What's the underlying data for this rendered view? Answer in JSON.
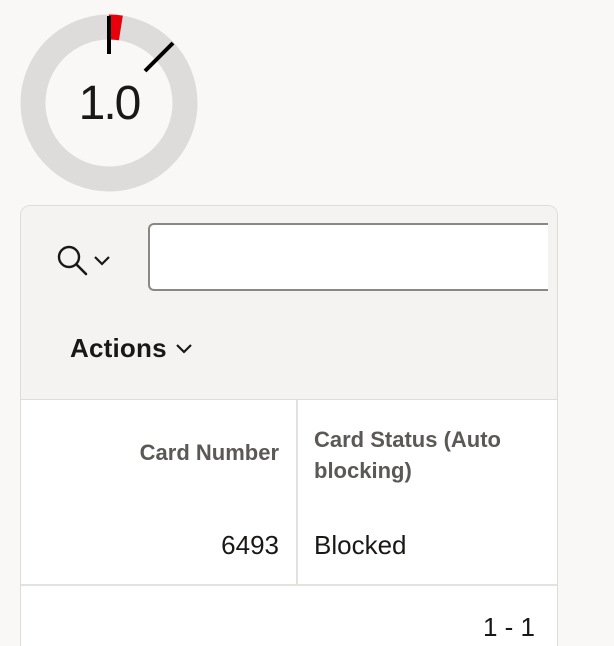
{
  "gauge": {
    "value_label": "1.0",
    "fraction": 0.025,
    "colors": {
      "track": "#dddcda",
      "fill": "#e8000b",
      "marker": "#000000"
    },
    "icon": "gauge-ring"
  },
  "report": {
    "search": {
      "icon": "search-icon",
      "dropdown_icon": "chevron-down-icon",
      "value": "",
      "placeholder": ""
    },
    "actions_label": "Actions",
    "columns": [
      "Card Number",
      "Card Status (Auto blocking)"
    ],
    "rows": [
      {
        "card_number": "6493",
        "card_status": "Blocked"
      }
    ],
    "pagination": "1 - 1"
  }
}
